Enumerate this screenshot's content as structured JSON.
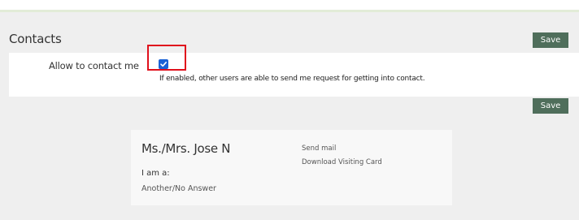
{
  "contacts": {
    "title": "Contacts",
    "save_label_top": "Save",
    "save_label_bottom": "Save",
    "allow_label": "Allow to contact me",
    "allow_checked": true,
    "hint": "If enabled, other users are able to send me request for getting into contact."
  },
  "card": {
    "name": "Ms./Mrs. Jose N",
    "iam_label": "I am a:",
    "iam_value": "Another/No Answer",
    "links": {
      "send_mail": "Send mail",
      "download_card": "Download Visiting Card"
    }
  },
  "colors": {
    "button_bg": "#4f6e5b",
    "checkbox": "#1a62d6",
    "highlight_box": "#e0101c"
  }
}
